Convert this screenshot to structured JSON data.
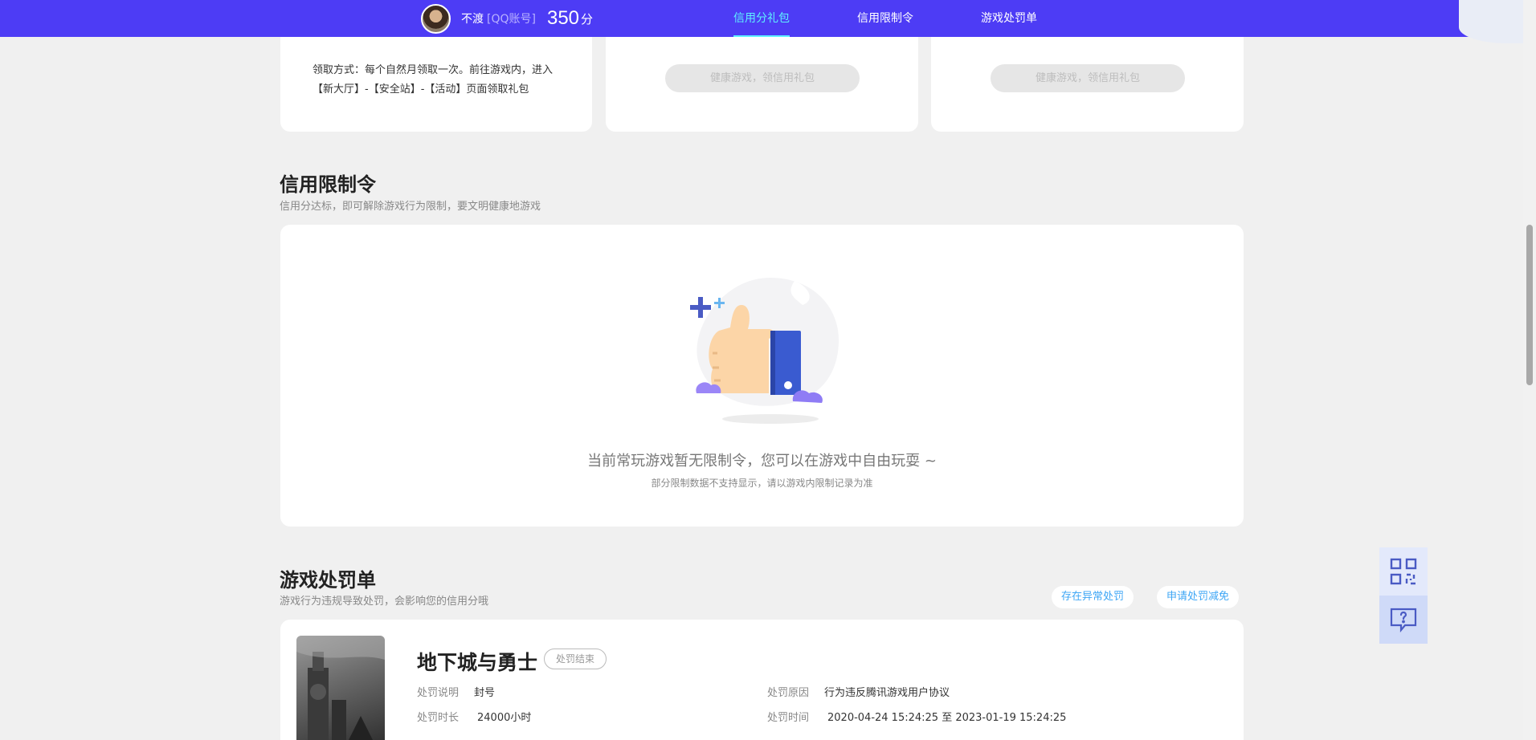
{
  "header": {
    "username": "不渡",
    "account_type": "[QQ账号]",
    "score": "350",
    "score_unit": "分",
    "nav": [
      {
        "label": "信用分礼包",
        "active": true
      },
      {
        "label": "信用限制令",
        "active": false
      },
      {
        "label": "游戏处罚单",
        "active": false
      }
    ]
  },
  "gift_cards": {
    "claim_text": "领取方式：每个自然月领取一次。前往游戏内，进入【新大厅】-【安全站】-【活动】页面领取礼包",
    "button_label_2": "健康游戏，领信用礼包",
    "button_label_3": "健康游戏，领信用礼包"
  },
  "restriction": {
    "title": "信用限制令",
    "subtitle": "信用分达标，即可解除游戏行为限制，要文明健康地游戏",
    "empty_message": "当前常玩游戏暂无限制令，您可以在游戏中自由玩耍 ~",
    "empty_note": "部分限制数据不支持显示，请以游戏内限制记录为准"
  },
  "punishment": {
    "title": "游戏处罚单",
    "subtitle": "游戏行为违规导致处罚，会影响您的信用分哦",
    "btn_abnormal": "存在异常处罚",
    "btn_reduce": "申请处罚减免",
    "game_name": "地下城与勇士",
    "status_badge": "处罚结束",
    "desc_label": "处罚说明",
    "desc_value": "封号",
    "duration_label": "处罚时长",
    "duration_value": "24000小时",
    "reason_label": "处罚原因",
    "reason_value": "行为违反腾讯游戏用户协议",
    "time_label": "处罚时间",
    "time_value": "2020-04-24 15:24:25 至 2023-01-19 15:24:25"
  },
  "colors": {
    "brand": "#4d3cf5",
    "active_nav": "#5ef1ff",
    "link": "#3ea6f5"
  },
  "tools": [
    {
      "icon": "qr-code-icon"
    },
    {
      "icon": "feedback-icon"
    }
  ]
}
